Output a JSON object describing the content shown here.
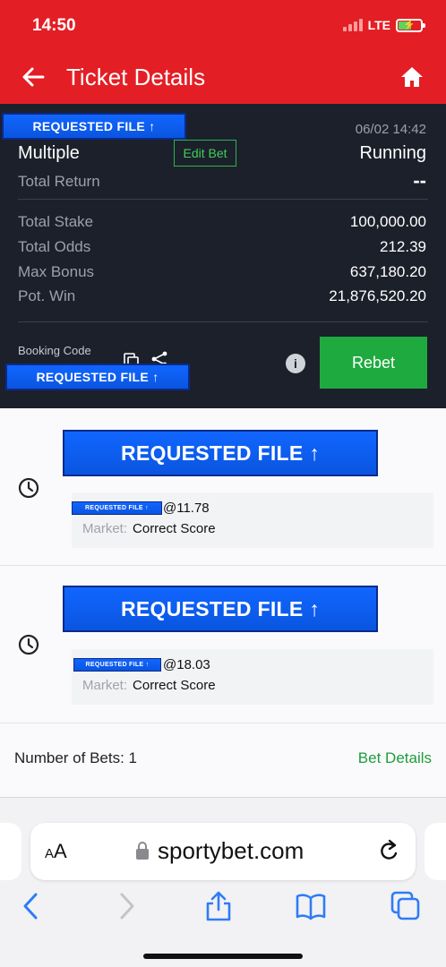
{
  "status": {
    "time": "14:50",
    "network": "LTE",
    "battery_bolt": "⚡"
  },
  "header": {
    "title": "Ticket Details"
  },
  "ticket": {
    "requested_badge": "REQUESTED FILE ↑",
    "date": "06/02 14:42",
    "bet_type": "Multiple",
    "edit_bet_label": "Edit Bet",
    "status": "Running",
    "total_return_label": "Total Return",
    "total_return_value": "--",
    "total_stake_label": "Total Stake",
    "total_stake_value": "100,000.00",
    "total_odds_label": "Total Odds",
    "total_odds_value": "212.39",
    "max_bonus_label": "Max Bonus",
    "max_bonus_value": "637,180.20",
    "pot_win_label": "Pot. Win",
    "pot_win_value": "21,876,520.20",
    "booking_code_label": "Booking Code",
    "booking_badge": "REQUESTED FILE ↑",
    "info_icon": "i",
    "rebet_label": "Rebet"
  },
  "selections": [
    {
      "badge": "REQUESTED FILE ↑",
      "small_badge": "REQUESTED FILE ↑",
      "odds": "@11.78",
      "market_label": "Market:",
      "market_value": "Correct Score"
    },
    {
      "badge": "REQUESTED FILE ↑",
      "small_badge": "REQUESTED FILE ↑",
      "odds": "@18.03",
      "market_label": "Market:",
      "market_value": "Correct Score"
    }
  ],
  "footer": {
    "num_bets": "Number of Bets: 1",
    "bet_details": "Bet Details"
  },
  "browser": {
    "aa_big": "A",
    "aa_small": "A",
    "url": "sportybet.com"
  },
  "colors": {
    "brand_red": "#e41e25",
    "dark_panel": "#1c202b",
    "accent_green": "#1eaa3f",
    "badge_blue": "#1166ff"
  },
  "icons": [
    "back-arrow-icon",
    "home-icon",
    "copy-icon",
    "share-icon",
    "info-icon",
    "clock-icon",
    "lock-icon",
    "reload-icon",
    "back-chevron-icon",
    "forward-chevron-icon",
    "share-box-icon",
    "bookmarks-icon",
    "tabs-icon"
  ]
}
